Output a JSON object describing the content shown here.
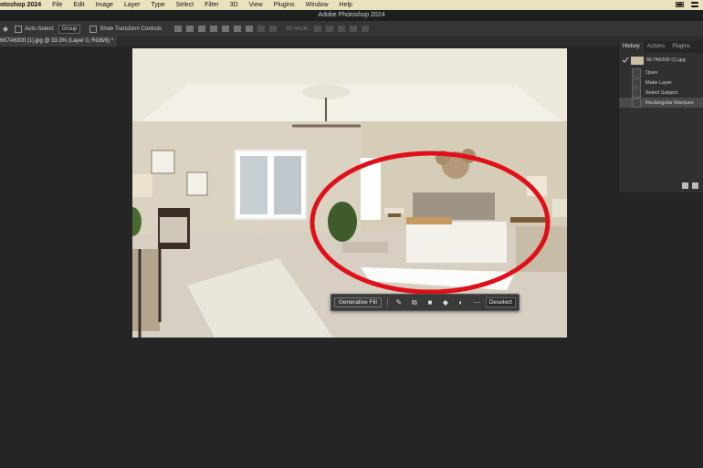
{
  "menubar": {
    "app": "otoshop 2024",
    "items": [
      "File",
      "Edit",
      "Image",
      "Layer",
      "Type",
      "Select",
      "Filter",
      "3D",
      "View",
      "Plugins",
      "Window",
      "Help"
    ]
  },
  "title": "Adobe Photoshop 2024",
  "options": {
    "auto_select_label": "Auto-Select:",
    "auto_select_value": "Group",
    "transform_label": "Show Transform Controls",
    "mode_label": "3D Mode:"
  },
  "doc_tab": "6K7A6300 (1).jpg @ 33.3% (Layer 0, RGB/8) *",
  "panel": {
    "tabs": [
      "History",
      "Actions",
      "Plugins"
    ],
    "snapshot": "6K7A6300 (1).jpg",
    "history": [
      "Open",
      "Make Layer",
      "Select Subject",
      "Rectangular Marquee"
    ]
  },
  "contextbar": {
    "generative_fill": "Generative Fill",
    "deselect": "Deselect"
  },
  "colors": {
    "menubar_bg": "#e9e3bd",
    "annotation": "#e0101a"
  }
}
